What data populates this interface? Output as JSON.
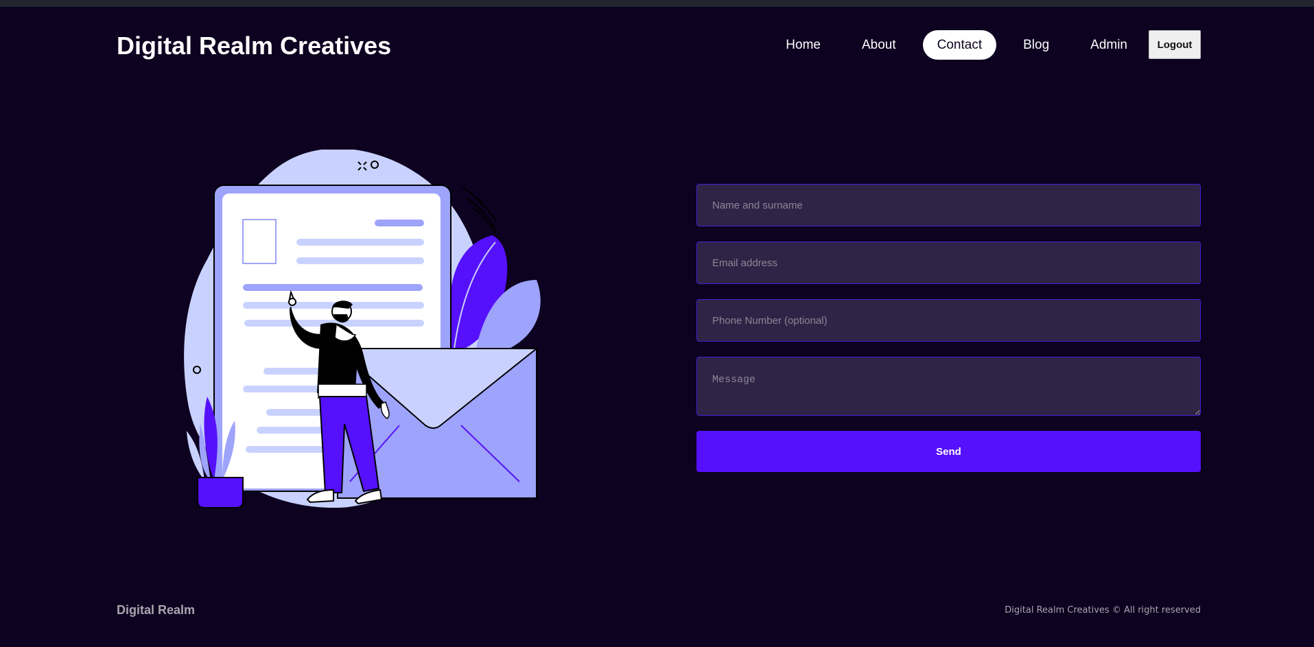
{
  "header": {
    "brand": "Digital Realm Creatives",
    "nav": [
      {
        "label": "Home",
        "active": false
      },
      {
        "label": "About",
        "active": false
      },
      {
        "label": "Contact",
        "active": true
      },
      {
        "label": "Blog",
        "active": false
      },
      {
        "label": "Admin",
        "active": false
      }
    ],
    "logout_label": "Logout"
  },
  "illustration": {
    "name": "contact-illustration",
    "icons": [
      "document-icon",
      "envelope-icon",
      "plant-icon",
      "person-figure"
    ]
  },
  "contact_form": {
    "name_placeholder": "Name and surname",
    "email_placeholder": "Email address",
    "phone_placeholder": "Phone Number (optional)",
    "message_placeholder": "Message",
    "send_label": "Send"
  },
  "footer": {
    "brand": "Digital Realm",
    "copyright": "Digital Realm Creatives © All right reserved"
  },
  "colors": {
    "background": "#0d0220",
    "accent": "#5511fb",
    "field_bg": "#2f2445",
    "field_border": "#4b1cd9",
    "illustration_light": "#c9d2ff",
    "illustration_mid": "#9ea3fb"
  }
}
